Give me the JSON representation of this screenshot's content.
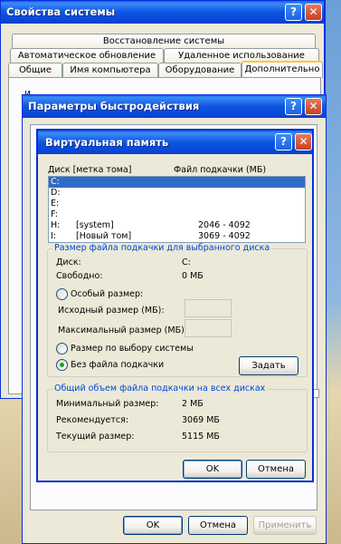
{
  "system_props": {
    "title": "Свойства системы",
    "help": "?",
    "close": "✕",
    "tabs_top": [
      "Восстановление системы"
    ],
    "tabs_mid": [
      "Автоматическое обновление",
      "Удаленное использование"
    ],
    "tabs_bottom": [
      "Общие",
      "Имя компьютера",
      "Оборудование",
      "Дополнительно"
    ],
    "ok": "OK",
    "cancel": "Отмена",
    "apply": "Применить",
    "partial_text": "И"
  },
  "perf": {
    "title": "Параметры быстродействия",
    "help": "?",
    "close": "✕"
  },
  "vm": {
    "title": "Виртуальная память",
    "help": "?",
    "close": "✕",
    "col_drive": "Диск [метка тома]",
    "col_pagefile": "Файл подкачки (МБ)",
    "drives": [
      {
        "letter": "C:",
        "label": "",
        "size": ""
      },
      {
        "letter": "D:",
        "label": "",
        "size": ""
      },
      {
        "letter": "E:",
        "label": "",
        "size": ""
      },
      {
        "letter": "F:",
        "label": "",
        "size": ""
      },
      {
        "letter": "H:",
        "label": "[system]",
        "size": "2046 - 4092"
      },
      {
        "letter": "I:",
        "label": "[Новый том]",
        "size": "3069 - 4092"
      }
    ],
    "group1_title": "Размер файла подкачки для выбранного диска",
    "disk_label": "Диск:",
    "disk_value": "C:",
    "free_label": "Свободно:",
    "free_value": "0 МБ",
    "custom_size": "Особый размер:",
    "initial_size": "Исходный размер (МБ):",
    "max_size": "Максимальный размер (МБ):",
    "system_size": "Размер по выбору системы",
    "no_pagefile": "Без файла подкачки",
    "set_button": "Задать",
    "group2_title": "Общий объем файла подкачки на всех дисках",
    "min_label": "Минимальный размер:",
    "min_value": "2 МБ",
    "rec_label": "Рекомендуется:",
    "rec_value": "3069 МБ",
    "cur_label": "Текущий размер:",
    "cur_value": "5115 МБ",
    "ok": "OK",
    "cancel": "Отмена"
  }
}
